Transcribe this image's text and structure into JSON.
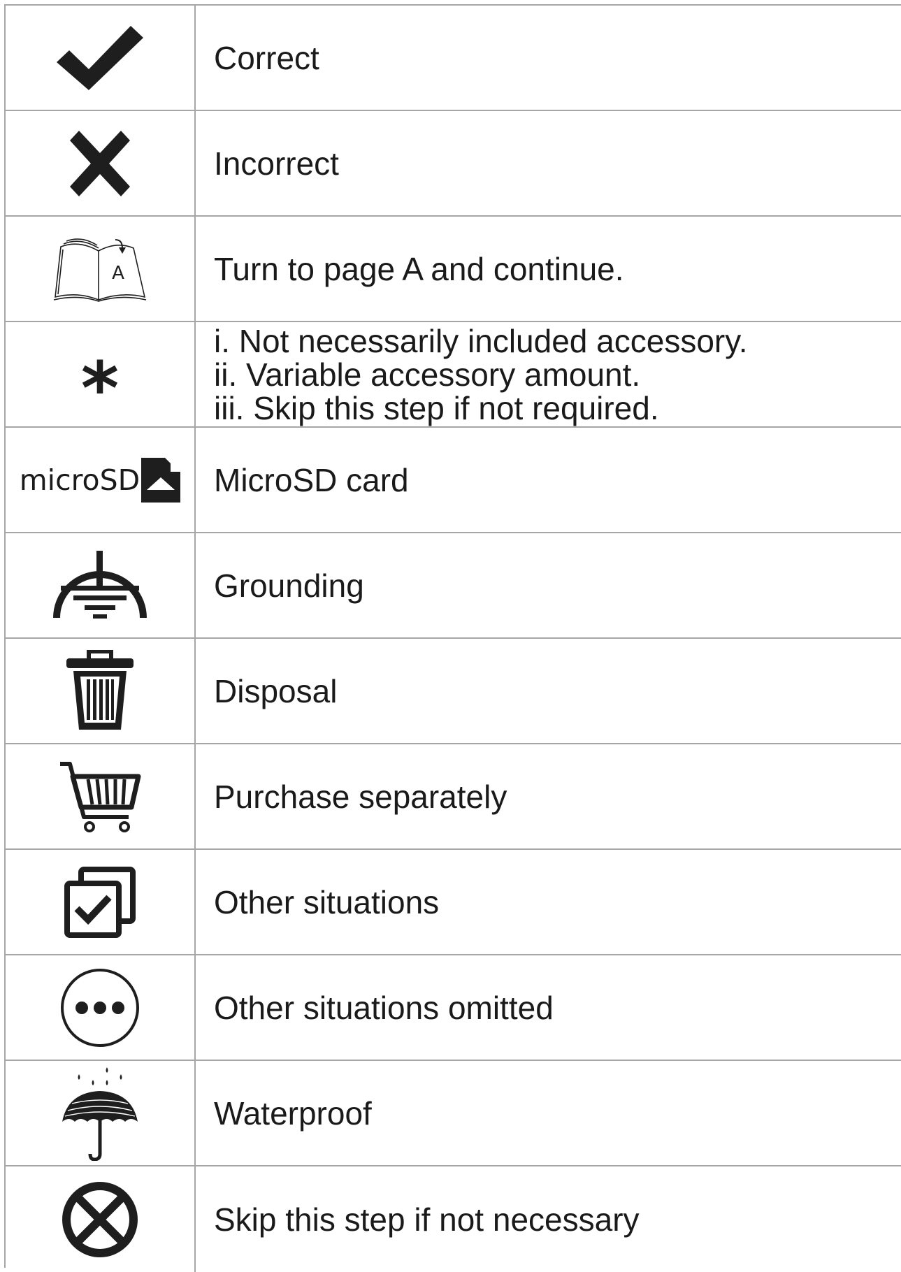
{
  "rows": [
    {
      "icon": "checkmark-icon",
      "label": "Correct"
    },
    {
      "icon": "cross-icon",
      "label": "Incorrect"
    },
    {
      "icon": "open-book-icon",
      "icon_text": "A",
      "label": "Turn to page A and continue."
    },
    {
      "icon": "asterisk-icon",
      "icon_text": "*",
      "lines": [
        "i. Not necessarily included accessory.",
        "ii. Variable accessory amount.",
        "iii. Skip this step if not required."
      ]
    },
    {
      "icon": "microsd-icon",
      "icon_text": "microSD",
      "label": "MicroSD card"
    },
    {
      "icon": "grounding-icon",
      "label": "Grounding"
    },
    {
      "icon": "trash-can-icon",
      "label": "Disposal"
    },
    {
      "icon": "shopping-cart-icon",
      "label": "Purchase separately"
    },
    {
      "icon": "checked-boxes-icon",
      "label": "Other situations"
    },
    {
      "icon": "ellipsis-circle-icon",
      "label": "Other situations omitted"
    },
    {
      "icon": "umbrella-rain-icon",
      "label": "Waterproof"
    },
    {
      "icon": "skip-circle-icon",
      "label": "Skip this step if not necessary"
    }
  ],
  "colors": {
    "icon": "#1e1e1e",
    "grid": "#a6a6a6",
    "text": "#1a1a1a"
  }
}
